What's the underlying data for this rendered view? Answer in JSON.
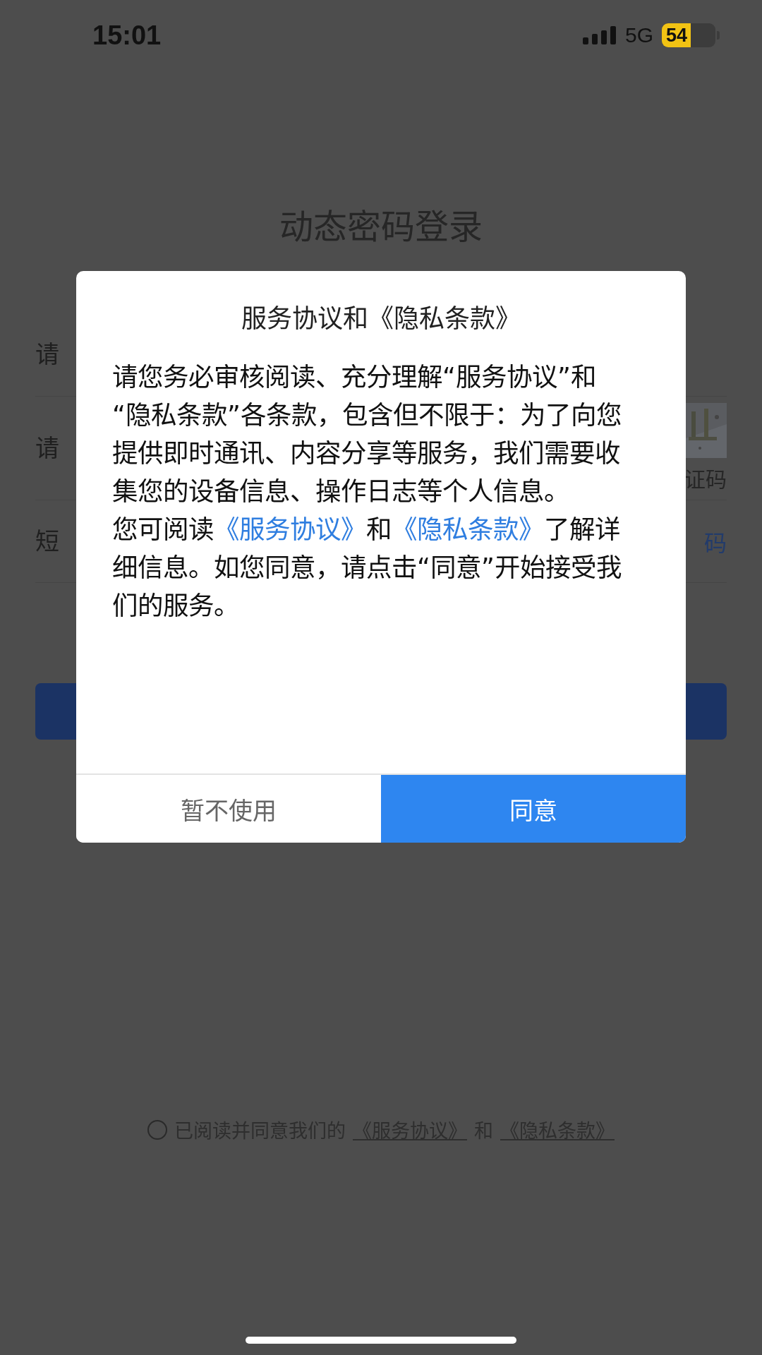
{
  "status_bar": {
    "time": "15:01",
    "network": "5G",
    "battery": "54"
  },
  "page": {
    "title": "动态密码登录",
    "fields": [
      {
        "kind": "input",
        "placeholder": "请"
      },
      {
        "kind": "captcha",
        "placeholder": "请",
        "caption": "证码"
      },
      {
        "kind": "sms",
        "placeholder": "短",
        "action": "码"
      }
    ],
    "agreement": {
      "checked": false,
      "prefix": "已阅读并同意我们的",
      "link1": "《服务协议》",
      "joiner": "和",
      "link2": "《隐私条款》"
    }
  },
  "dialog": {
    "title": "服务协议和《隐私条款》",
    "paragraphs": [
      [
        {
          "text": "请您务必审核阅读、充分理解“服务协议”和“隐私条款”各条款，包含但不限于：为了向您提供即时通讯、内容分享等服务，我们需要收集您的设备信息、操作日志等个人信息。",
          "link": false
        }
      ],
      [
        {
          "text": "您可阅读",
          "link": false
        },
        {
          "text": "《服务协议》",
          "link": true
        },
        {
          "text": "和",
          "link": false
        },
        {
          "text": "《隐私条款》",
          "link": true
        },
        {
          "text": "了解详细信息。如您同意，请点击“同意”开始接受我们的服务。",
          "link": false
        }
      ]
    ],
    "buttons": [
      {
        "label": "暂不使用",
        "kind": "secondary"
      },
      {
        "label": "同意",
        "kind": "primary"
      }
    ]
  }
}
